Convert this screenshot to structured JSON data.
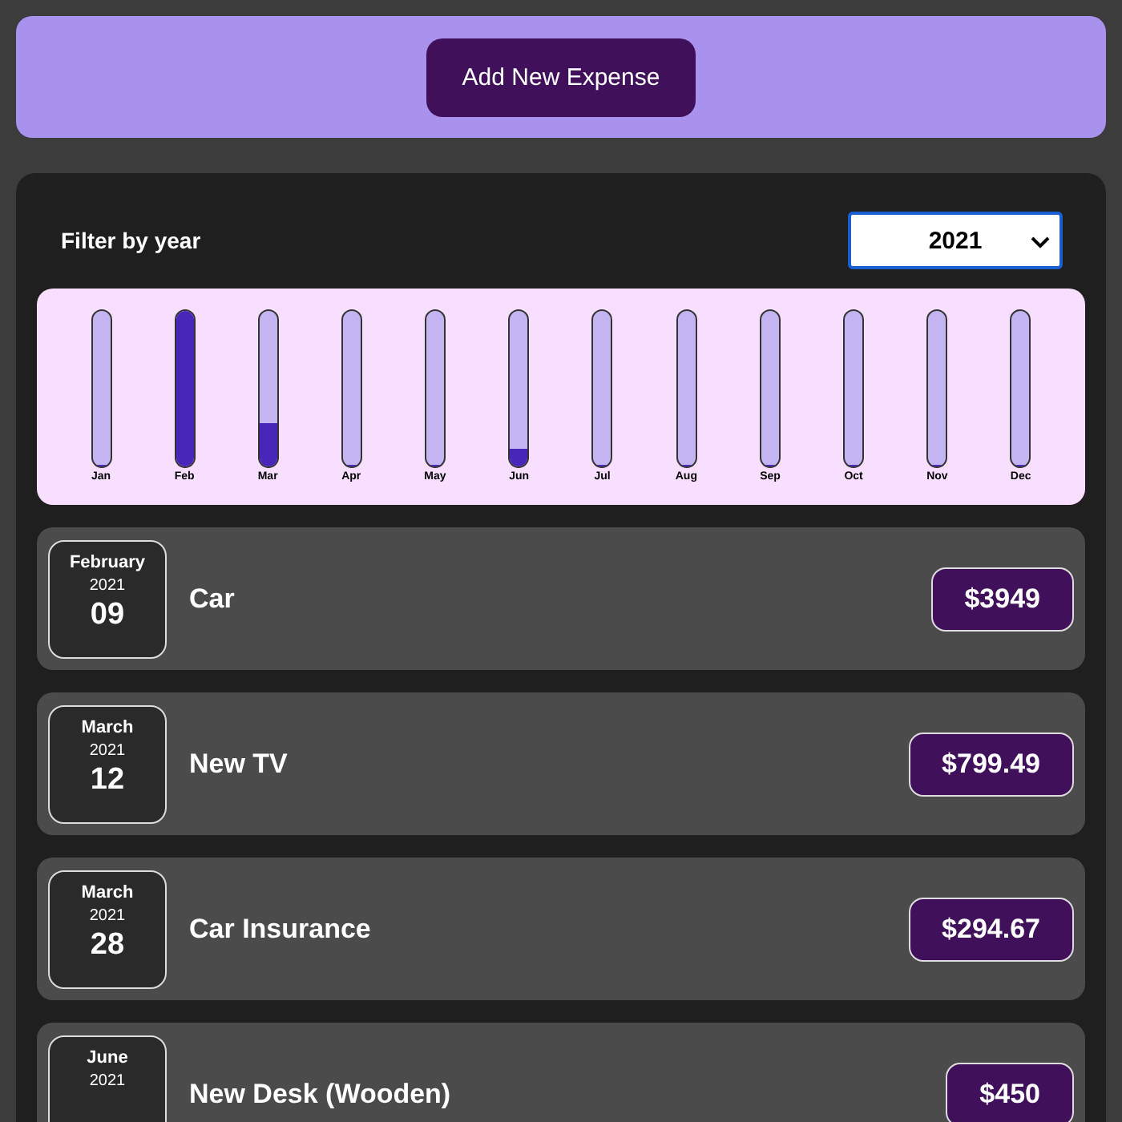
{
  "add_button": {
    "label": "Add New Expense"
  },
  "filter": {
    "label": "Filter by year",
    "year": "2021"
  },
  "chart": [
    {
      "label": "Jan",
      "level": 0
    },
    {
      "label": "Feb",
      "level": 1
    },
    {
      "label": "Mar",
      "level": 0.28
    },
    {
      "label": "Apr",
      "level": 0
    },
    {
      "label": "May",
      "level": 0
    },
    {
      "label": "Jun",
      "level": 0.11
    },
    {
      "label": "Jul",
      "level": 0
    },
    {
      "label": "Aug",
      "level": 0
    },
    {
      "label": "Sep",
      "level": 0
    },
    {
      "label": "Oct",
      "level": 0
    },
    {
      "label": "Nov",
      "level": 0
    },
    {
      "label": "Dec",
      "level": 0
    }
  ],
  "expenses": [
    {
      "month": "February",
      "year": "2021",
      "day": "09",
      "title": "Car",
      "amount": "$3949"
    },
    {
      "month": "March",
      "year": "2021",
      "day": "12",
      "title": "New TV",
      "amount": "$799.49"
    },
    {
      "month": "March",
      "year": "2021",
      "day": "28",
      "title": "Car Insurance",
      "amount": "$294.67"
    },
    {
      "month": "June",
      "year": "2021",
      "title": "New Desk (Wooden)",
      "amount": "$450"
    }
  ]
}
